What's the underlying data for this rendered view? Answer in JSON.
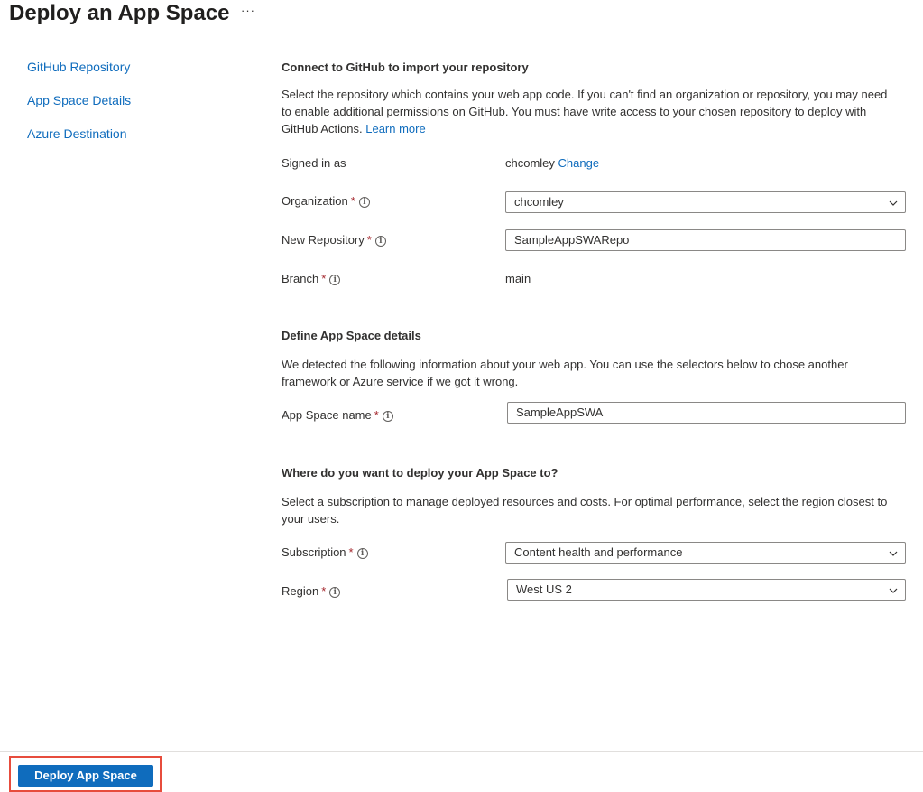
{
  "header": {
    "title": "Deploy an App Space",
    "more_label": "···"
  },
  "nav": {
    "items": [
      "GitHub Repository",
      "App Space Details",
      "Azure Destination"
    ]
  },
  "github": {
    "heading": "Connect to GitHub to import your repository",
    "description": "Select the repository which contains your web app code. If you can't find an organization or repository, you may need to enable additional permissions on GitHub. You must have write access to your chosen repository to deploy with GitHub Actions.",
    "learn_more": "Learn more",
    "signed_in_label": "Signed in as",
    "signed_in_user": "chcomley",
    "change_link": "Change",
    "organization_label": "Organization",
    "organization_value": "chcomley",
    "repo_label": "New Repository",
    "repo_value": "SampleAppSWARepo",
    "branch_label": "Branch",
    "branch_value": "main"
  },
  "details": {
    "heading": "Define App Space details",
    "description": "We detected the following information about your web app. You can use the selectors below to chose another framework or Azure service if we got it wrong.",
    "name_label": "App Space name",
    "name_value": "SampleAppSWA"
  },
  "destination": {
    "heading": "Where do you want to deploy your App Space to?",
    "description": "Select a subscription to manage deployed resources and costs. For optimal performance, select the region closest to your users.",
    "subscription_label": "Subscription",
    "subscription_value": "Content health and performance",
    "region_label": "Region",
    "region_value": "West US 2"
  },
  "required_marker": "*",
  "info_glyph": "i",
  "footer": {
    "deploy_label": "Deploy App Space"
  },
  "colors": {
    "accent": "#0f6cbd",
    "highlight_border": "#e74c3c"
  }
}
